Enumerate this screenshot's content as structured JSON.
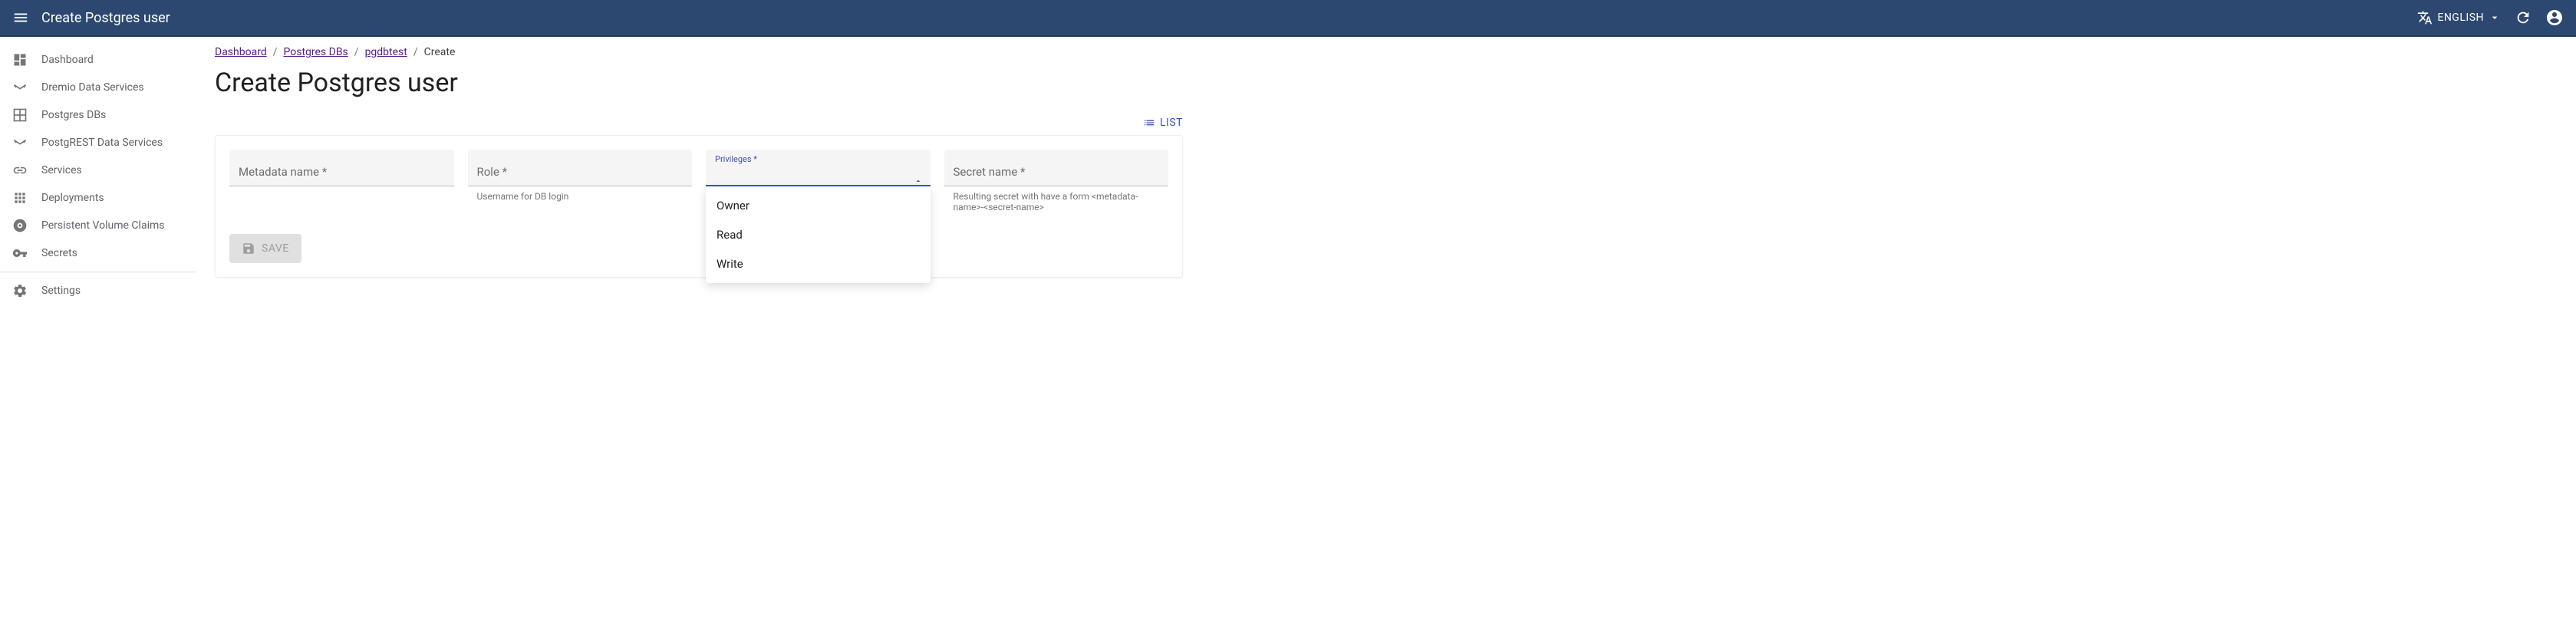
{
  "appbar": {
    "title": "Create Postgres user",
    "language": "ENGLISH"
  },
  "sidebar": {
    "items": [
      {
        "label": "Dashboard"
      },
      {
        "label": "Dremio Data Services"
      },
      {
        "label": "Postgres DBs"
      },
      {
        "label": "PostgREST Data Services"
      },
      {
        "label": "Services"
      },
      {
        "label": "Deployments"
      },
      {
        "label": "Persistent Volume Claims"
      },
      {
        "label": "Secrets"
      }
    ],
    "settings_label": "Settings"
  },
  "breadcrumb": {
    "items": [
      "Dashboard",
      "Postgres DBs",
      "pgdbtest"
    ],
    "current": "Create"
  },
  "page": {
    "title": "Create Postgres user",
    "list_label": "LIST"
  },
  "form": {
    "metadata_name": {
      "label": "Metadata name *"
    },
    "role": {
      "label": "Role *",
      "helper": "Username for DB login"
    },
    "privileges": {
      "label": "Privileges *",
      "options": [
        "Owner",
        "Read",
        "Write"
      ]
    },
    "secret_name": {
      "label": "Secret name *",
      "helper": "Resulting secret with have a form <metadata-name>-<secret-name>"
    },
    "save_label": "SAVE"
  }
}
